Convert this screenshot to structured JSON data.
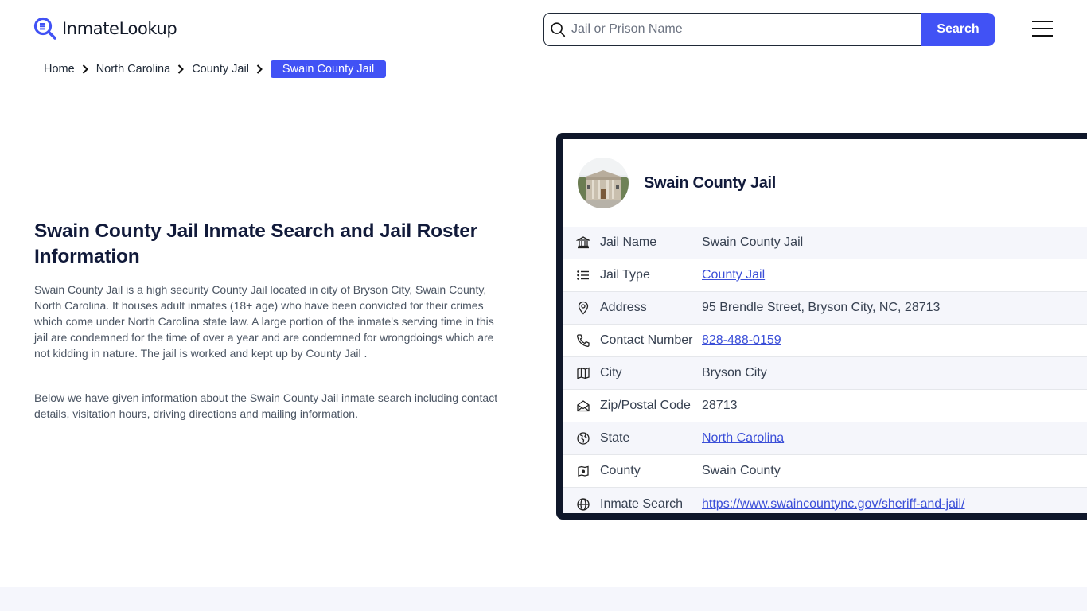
{
  "header": {
    "logo_text": "InmateLookup",
    "search_placeholder": "Jail or Prison Name",
    "search_value": "",
    "search_button": "Search",
    "menu_icon": "hamburger-menu-icon"
  },
  "breadcrumb": {
    "items": [
      "Home",
      "North Carolina",
      "County Jail"
    ],
    "current": "Swain County Jail"
  },
  "main": {
    "title": "Swain County Jail Inmate Search and Jail Roster Information",
    "paragraphs": [
      "Swain County Jail is a high security County Jail located in city of Bryson City, Swain County, North Carolina. It houses adult inmates (18+ age) who have been convicted for their crimes which come under North Carolina state law. A large portion of the inmate's serving time in this jail are condemned for the time of over a year and are condemned for wrongdoings which are not kidding in nature. The jail is worked and kept up by County Jail .",
      "Below we have given information about the Swain County Jail inmate search including contact details, visitation hours, driving directions and mailing information."
    ]
  },
  "card": {
    "title": "Swain County Jail",
    "rows": [
      {
        "icon": "building-columns-icon",
        "label": "Jail Name",
        "value": "Swain County Jail",
        "link": false
      },
      {
        "icon": "list-icon",
        "label": "Jail Type",
        "value": "County Jail",
        "link": true
      },
      {
        "icon": "map-pin-icon",
        "label": "Address",
        "value": "95 Brendle Street, Bryson City, NC, 28713",
        "link": false
      },
      {
        "icon": "phone-icon",
        "label": "Contact Number",
        "value": "828-488-0159",
        "link": true
      },
      {
        "icon": "map-icon",
        "label": "City",
        "value": "Bryson City",
        "link": false
      },
      {
        "icon": "mail-open-icon",
        "label": "Zip/Postal Code",
        "value": "28713",
        "link": false
      },
      {
        "icon": "state-globe-icon",
        "label": "State",
        "value": "North Carolina",
        "link": true
      },
      {
        "icon": "county-map-icon",
        "label": "County",
        "value": "Swain County",
        "link": false
      },
      {
        "icon": "globe-icon",
        "label": "Inmate Search",
        "value": "https://www.swaincountync.gov/sheriff-and-jail/",
        "link": true
      }
    ]
  },
  "colors": {
    "accent": "#4152f5",
    "card_border": "#0f172a",
    "link": "#3b4fd8",
    "row_alt_bg": "#f5f6fb"
  }
}
